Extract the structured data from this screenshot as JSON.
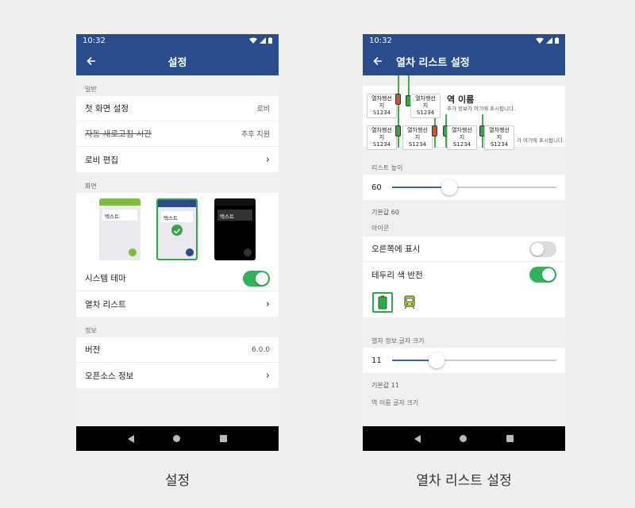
{
  "status": {
    "time": "10:32"
  },
  "left": {
    "title": "설정",
    "sections": {
      "general": "일반",
      "screen": "화면",
      "info": "정보"
    },
    "general_rows": [
      {
        "label": "첫 화면 설정",
        "value": "로비"
      },
      {
        "label": "자동 새로고침 시간",
        "value": "추후 지원"
      },
      {
        "label": "로비 편집",
        "value": ""
      }
    ],
    "theme_text": [
      "텍스트",
      "텍스트",
      "텍스트"
    ],
    "system_theme": "시스템 테마",
    "train_list": "열차 리스트",
    "version_label": "버전",
    "version_value": "6.0.0",
    "oss_label": "오픈소스 정보",
    "caption": "설정"
  },
  "right": {
    "title": "열차 리스트 설정",
    "preview": {
      "station_name": "역 이름",
      "sub_info": "추가 정보가 여기에 표시됩니다.",
      "sub_info_2": "가 여기에 표시됩니다.",
      "train_dest": "열차행선지",
      "train_no": "S1234"
    },
    "list_height_label": "리스트 높이",
    "list_height_value": "60",
    "list_height_default": "기본값 60",
    "icon_section": "아이콘",
    "show_right": "오른쪽에 표시",
    "border_invert": "테두리 색 반전",
    "info_font_label": "열차 정보 글자 크기",
    "info_font_value": "11",
    "info_font_default": "기본값 11",
    "station_font_label": "역 이름 글자 크기",
    "caption": "열차 리스트 설정"
  },
  "colors": {
    "appbar": "#2b4c8c",
    "toggle_on": "#2fb45a",
    "slider": "#3b63b8"
  },
  "controls": {
    "system_theme_on": true,
    "show_right_on": false,
    "border_invert_on": true,
    "list_height_fraction": 0.35,
    "info_font_fraction": 0.27
  }
}
